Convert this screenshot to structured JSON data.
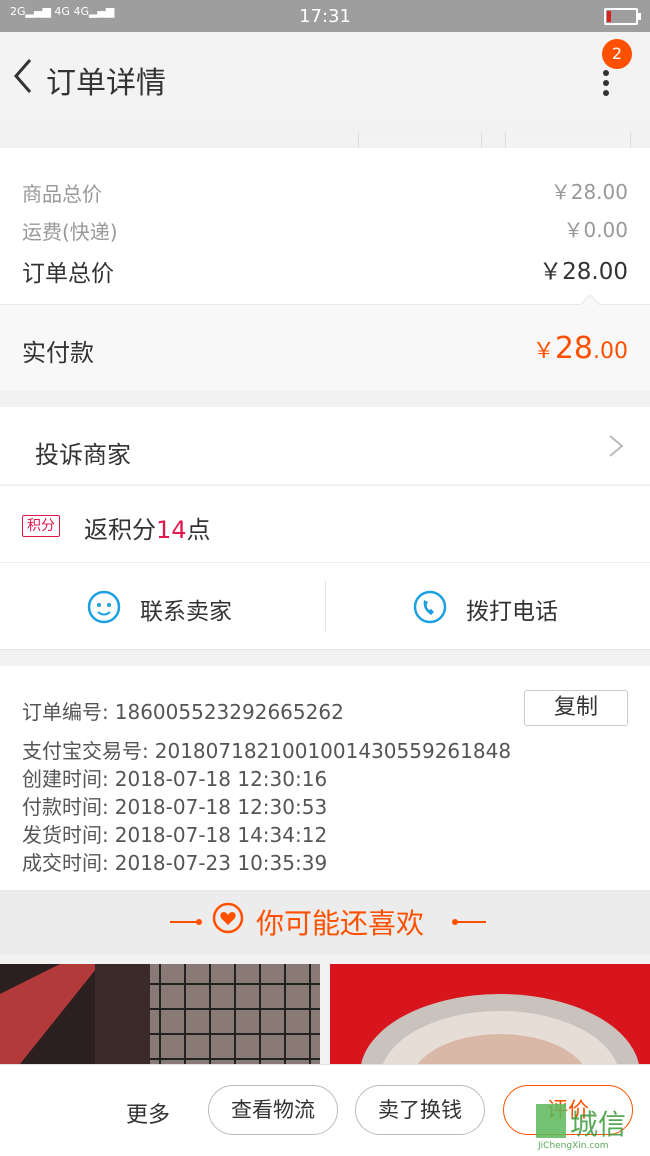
{
  "status_bar": {
    "signal_left": "2G",
    "network": "4G 4G",
    "time": "17:31"
  },
  "header": {
    "title": "订单详情",
    "badge_count": "2"
  },
  "price_summary": {
    "goods_label": "商品总价",
    "goods_value": "￥28.00",
    "shipping_label": "运费(快递)",
    "shipping_value": "￥0.00",
    "total_label": "订单总价",
    "total_value": "￥28.00",
    "paid_label": "实付款",
    "paid_currency": "￥",
    "paid_int": "28",
    "paid_dec": ".00"
  },
  "complaint": {
    "label": "投诉商家"
  },
  "points": {
    "tag": "积分",
    "prefix": "返积分",
    "number": "14",
    "suffix": "点"
  },
  "contact": {
    "seller_label": "联系卖家",
    "phone_label": "拨打电话"
  },
  "order_info": {
    "copy_label": "复制",
    "rows": [
      {
        "key": "订单编号:",
        "value": "186005523292665262"
      },
      {
        "key": "支付宝交易号:",
        "value": "2018071821001001430559261848"
      },
      {
        "key": "创建时间:",
        "value": "2018-07-18 12:30:16"
      },
      {
        "key": "付款时间:",
        "value": "2018-07-18 12:30:53"
      },
      {
        "key": "发货时间:",
        "value": "2018-07-18 14:34:12"
      },
      {
        "key": "成交时间:",
        "value": "2018-07-23 10:35:39"
      }
    ]
  },
  "recommend": {
    "title": "你可能还喜欢"
  },
  "bottom_bar": {
    "more_label": "更多",
    "logistics_label": "查看物流",
    "resell_label": "卖了换钱",
    "review_label": "评价"
  },
  "watermark": {
    "brand": "城信",
    "url": "JiChengXin.com"
  },
  "colors": {
    "accent": "#ff5000",
    "points": "#e0184b",
    "icon_blue": "#1ba0e2"
  }
}
